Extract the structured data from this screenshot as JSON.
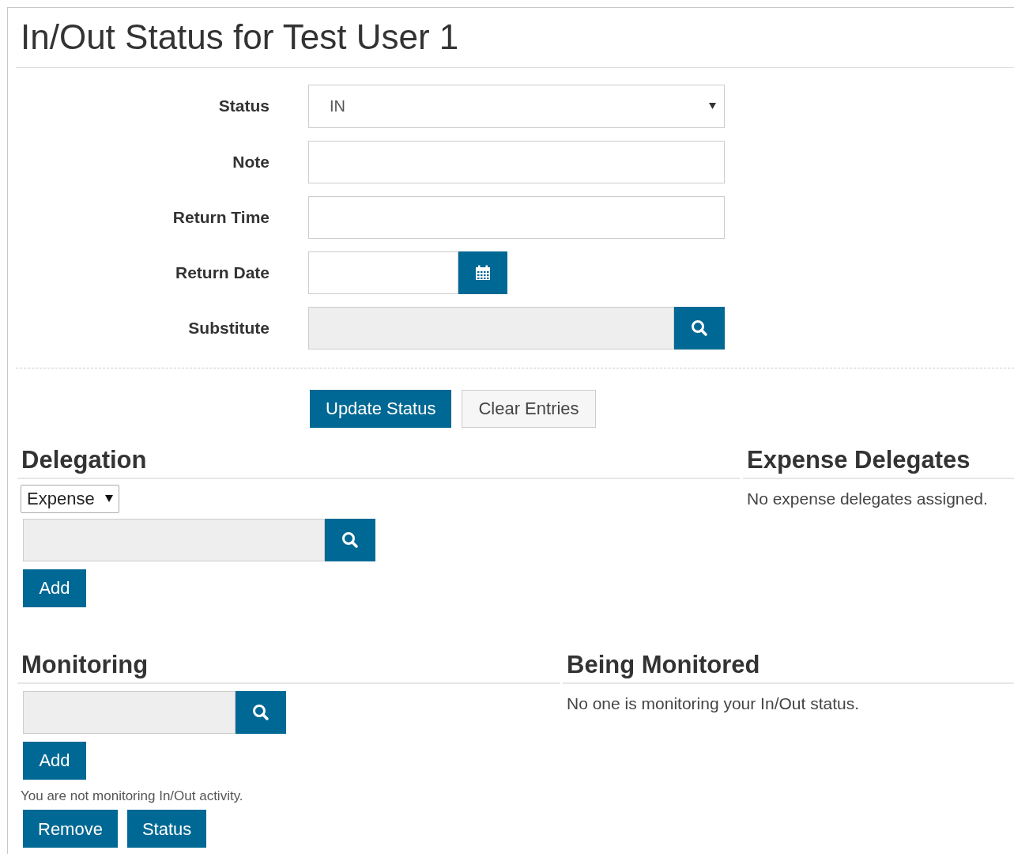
{
  "title": "In/Out Status for Test User 1",
  "form": {
    "fields": [
      {
        "label": "Status",
        "kind": "select",
        "value": "IN"
      },
      {
        "label": "Note",
        "kind": "text"
      },
      {
        "label": "Return Time",
        "kind": "text"
      },
      {
        "label": "Return Date",
        "kind": "date"
      },
      {
        "label": "Substitute",
        "kind": "lookup"
      }
    ],
    "buttons": [
      {
        "label": "Update Status",
        "kind": "primary"
      },
      {
        "label": "Clear Entries",
        "kind": "secondary"
      }
    ]
  },
  "delegation": {
    "heading": "Delegation",
    "type_select": "Expense",
    "add_button": "Add"
  },
  "expense_delegates": {
    "heading": "Expense Delegates",
    "message": "No expense delegates assigned."
  },
  "monitoring": {
    "heading": "Monitoring",
    "add_button": "Add",
    "message": "You are not monitoring In/Out activity.",
    "buttons": [
      "Remove",
      "Status"
    ]
  },
  "being_monitored": {
    "heading": "Being Monitored",
    "message": "No one is monitoring your In/Out status."
  }
}
